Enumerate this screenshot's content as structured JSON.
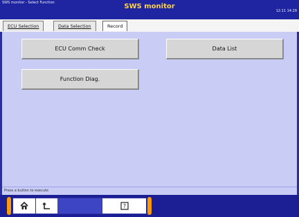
{
  "window": {
    "path": "SWS monitor - Select Function",
    "title": "SWS monitor",
    "datetime": "12:11 14:29"
  },
  "tabs": [
    {
      "label": "ECU Selection",
      "active": false
    },
    {
      "label": "Data Selection",
      "active": false
    },
    {
      "label": "Record",
      "active": true
    }
  ],
  "buttons": {
    "ecu_comm_check": "ECU Comm Check",
    "data_list": "Data List",
    "function_diag": "Function Diag."
  },
  "status_bar": {
    "text": "Press a button to execute"
  },
  "toolbar": {
    "icons": [
      "home-icon",
      "back-icon",
      "blank",
      "blank",
      "help-icon"
    ],
    "accent": "#ff9900"
  }
}
